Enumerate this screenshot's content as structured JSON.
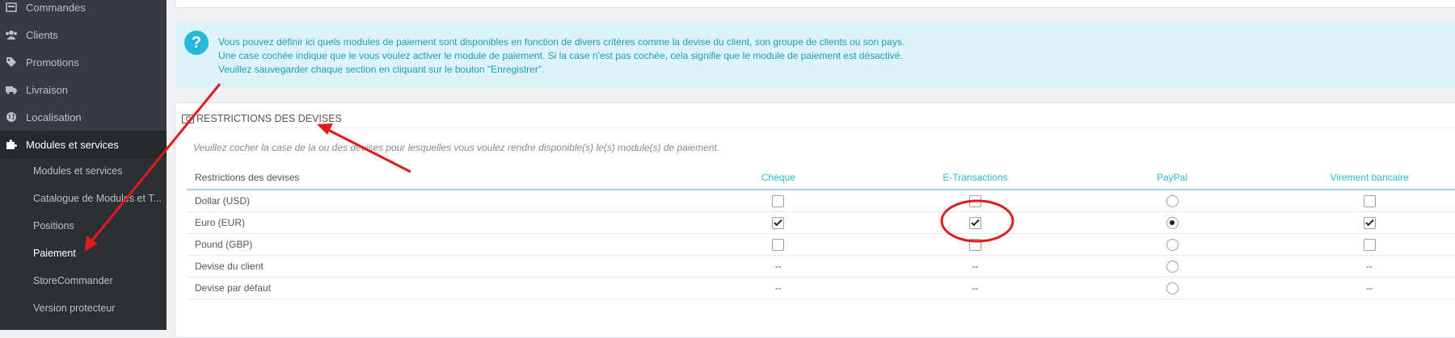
{
  "sidebar": {
    "items": [
      {
        "label": "Commandes",
        "icon": "inbox-icon"
      },
      {
        "label": "Clients",
        "icon": "users-icon"
      },
      {
        "label": "Promotions",
        "icon": "tags-icon"
      },
      {
        "label": "Livraison",
        "icon": "truck-icon"
      },
      {
        "label": "Localisation",
        "icon": "globe-icon"
      },
      {
        "label": "Modules et services",
        "icon": "puzzle-icon"
      }
    ],
    "submenu": [
      {
        "label": "Modules et services"
      },
      {
        "label": "Catalogue de Modules et T..."
      },
      {
        "label": "Positions"
      },
      {
        "label": "Paiement"
      },
      {
        "label": "StoreCommander"
      },
      {
        "label": "Version protecteur"
      }
    ]
  },
  "info": {
    "line1": "Vous pouvez définir ici quels modules de paiement sont disponibles en fonction de divers critères comme la devise du client, son groupe de clients ou son pays.",
    "line2": "Une case cochée indique que le vous voulez activer le module de paiement. Si la case n'est pas cochée, cela signifie que le module de paiement est désactivé.",
    "line3": "Veuillez sauvegarder chaque section en cliquant sur le bouton \"Enregistrer\"."
  },
  "panel": {
    "title": "Restrictions des devises",
    "help": "Veuillez cocher la case de la ou des devises pour lesquelles vous voulez rendre disponible(s) le(s) module(s) de paiement."
  },
  "table": {
    "header": "Restrictions des devises",
    "columns": [
      "Chèque",
      "E-Transactions",
      "PayPal",
      "Virement bancaire"
    ],
    "rows": [
      {
        "label": "Dollar (USD)",
        "cells": [
          "unchecked",
          "unchecked",
          "radio-off",
          "unchecked"
        ]
      },
      {
        "label": "Euro (EUR)",
        "cells": [
          "checked",
          "checked",
          "radio-on",
          "checked"
        ]
      },
      {
        "label": "Pound (GBP)",
        "cells": [
          "unchecked",
          "unchecked",
          "radio-off",
          "unchecked"
        ]
      },
      {
        "label": "Devise du client",
        "cells": [
          "--",
          "--",
          "radio-off",
          "--"
        ]
      },
      {
        "label": "Devise par défaut",
        "cells": [
          "--",
          "--",
          "radio-off",
          "--"
        ]
      }
    ]
  },
  "colors": {
    "annotation": "#e01b1b",
    "accent": "#25b9d7",
    "sidebar": "#363a41"
  }
}
